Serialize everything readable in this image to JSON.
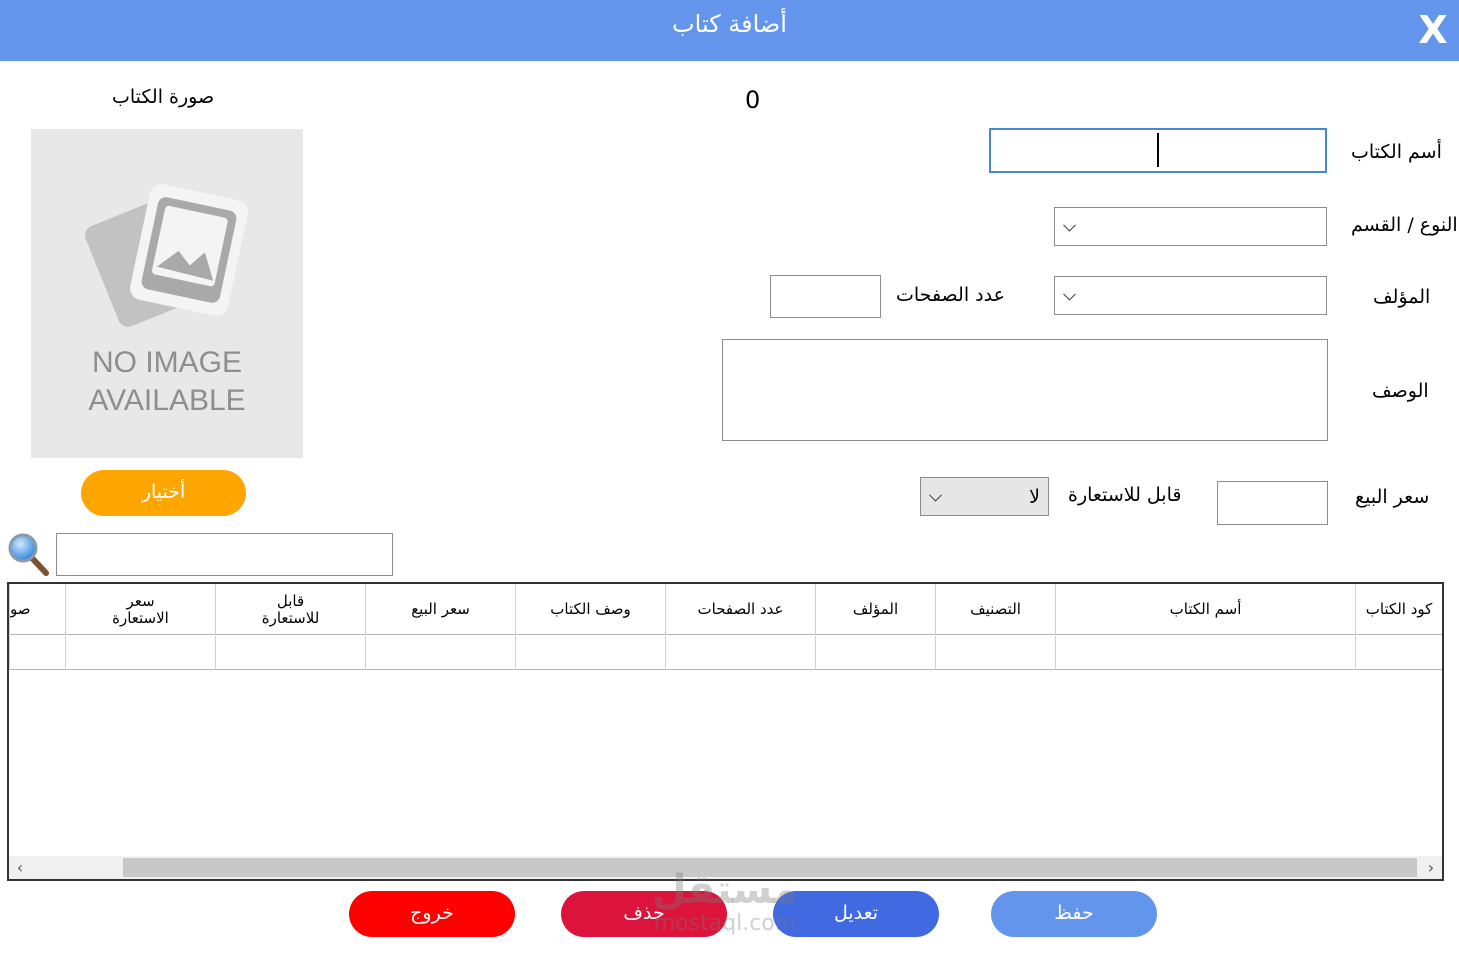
{
  "window": {
    "title": "أضافة كتاب",
    "close_label": "X"
  },
  "form": {
    "counter": "0",
    "book_name_label": "أسم الكتاب",
    "book_name_value": "",
    "category_label": "النوع / القسم",
    "category_value": "",
    "author_label": "المؤلف",
    "author_value": "",
    "pages_label": "عدد الصفحات",
    "pages_value": "",
    "description_label": "الوصف",
    "description_value": "",
    "price_label": "سعر البيع",
    "price_value": "",
    "borrowable_label": "قابل للاستعارة",
    "borrowable_value": "لا"
  },
  "image_panel": {
    "label": "صورة الكتاب",
    "placeholder_line1": "NO IMAGE",
    "placeholder_line2": "AVAILABLE",
    "choose_button": "أختيار"
  },
  "search": {
    "value": ""
  },
  "table": {
    "columns": [
      "كود الكتاب",
      "أسم الكتاب",
      "التصنيف",
      "المؤلف",
      "عدد الصفحات",
      "وصف الكتاب",
      "سعر البيع",
      "قابل للاستعارة",
      "سعر الاستعارة",
      "صو"
    ],
    "rows": [
      [
        "",
        "",
        "",
        "",
        "",
        "",
        "",
        "",
        "",
        ""
      ]
    ]
  },
  "actions": {
    "save": "حفظ",
    "edit": "تعديل",
    "delete": "حذف",
    "exit": "خروج"
  },
  "watermark": {
    "arabic": "مستقل",
    "latin": "mostaql.com"
  },
  "colors": {
    "titlebar": "#6495ed",
    "choose_button": "#ffa500",
    "save_button": "#6495ed",
    "edit_button": "#4169e1",
    "delete_button": "#dc143c",
    "exit_button": "#ff0000"
  }
}
